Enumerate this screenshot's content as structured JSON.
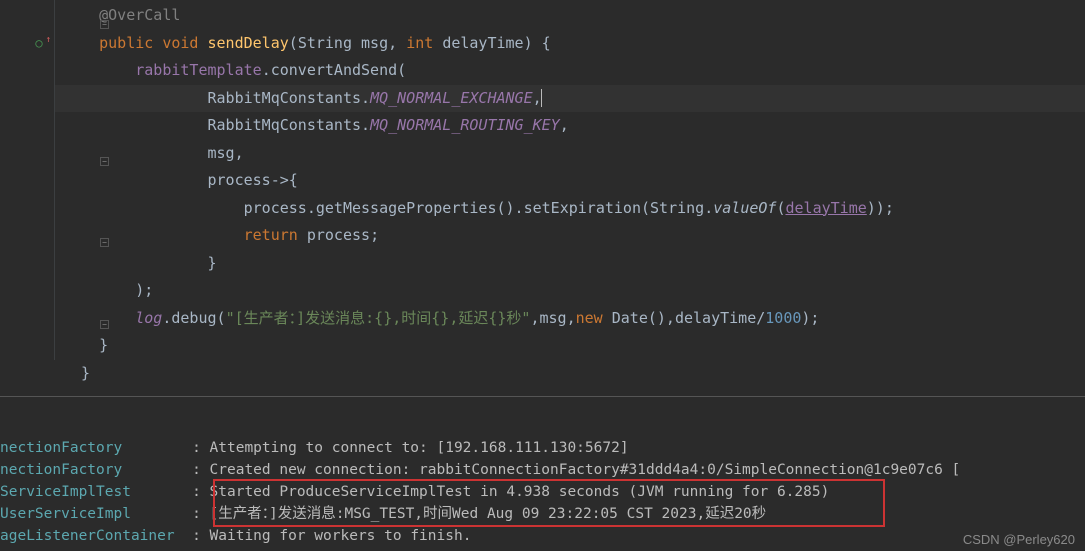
{
  "code": {
    "anno": "@OverCall",
    "sig_public": "public",
    "sig_void": "void",
    "sig_method": "sendDelay",
    "sig_p1type": "String",
    "sig_p1": "msg",
    "sig_int": "int",
    "sig_p2": "delayTime",
    "l2_obj": "rabbitTemplate",
    "l2_meth": "convertAndSend",
    "l3_cls": "RabbitMqConstants",
    "l3_const": "MQ_NORMAL_EXCHANGE",
    "l4_cls": "RabbitMqConstants",
    "l4_const": "MQ_NORMAL_ROUTING_KEY",
    "l5_msg": "msg",
    "l6_proc": "process",
    "l7_obj": "process",
    "l7_m1": "getMessageProperties",
    "l7_m2": "setExpiration",
    "l7_cls": "String",
    "l7_m3": "valueOf",
    "l7_arg": "delayTime",
    "l8_ret": "return",
    "l8_proc": "process",
    "l11_log": "log",
    "l11_meth": "debug",
    "l11_str": "\"[生产者：]发送消息:{},时间{},延迟{}秒\"",
    "l11_msg": "msg",
    "l11_new": "new",
    "l11_cls": "Date",
    "l11_dt": "delayTime",
    "l11_num": "1000"
  },
  "console": {
    "c1_class": "nectionFactory",
    "c1_msg": ": Attempting to connect to: [192.168.111.130:5672]",
    "c2_class": "nectionFactory",
    "c2_msg": ": Created new connection: rabbitConnectionFactory#31ddd4a4:0/SimpleConnection@1c9e07c6 [",
    "c3_class": "ServiceImplTest",
    "c3_msg": ": Started ProduceServiceImplTest in 4.938 seconds (JVM running for 6.285)",
    "c4_class": "UserServiceImpl",
    "c4_msg": ": [生产者：]发送消息:MSG_TEST,时间Wed Aug 09 23:22:05 CST 2023,延迟20秒",
    "c5_class": "ageListenerContainer",
    "c5_msg": ": Waiting for workers to finish."
  },
  "watermark": "CSDN @Perley620"
}
